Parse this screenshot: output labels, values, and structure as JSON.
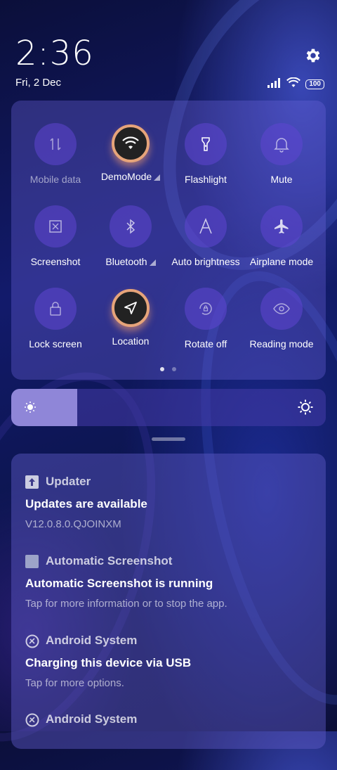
{
  "status": {
    "time": "2:36",
    "date": "Fri, 2 Dec",
    "battery": "100"
  },
  "quick_settings": {
    "tiles": [
      {
        "label": "Mobile data",
        "icon": "mobile-data-icon",
        "active": false,
        "dim": true,
        "arrow": false
      },
      {
        "label": "DemoMode",
        "icon": "wifi-icon",
        "active": true,
        "dim": false,
        "arrow": true
      },
      {
        "label": "Flashlight",
        "icon": "flashlight-icon",
        "active": false,
        "dim": false,
        "arrow": false
      },
      {
        "label": "Mute",
        "icon": "bell-icon",
        "active": false,
        "dim": false,
        "arrow": false
      },
      {
        "label": "Screenshot",
        "icon": "screenshot-icon",
        "active": false,
        "dim": false,
        "arrow": false
      },
      {
        "label": "Bluetooth",
        "icon": "bluetooth-icon",
        "active": false,
        "dim": false,
        "arrow": true
      },
      {
        "label": "Auto brightness",
        "icon": "auto-brightness-icon",
        "active": false,
        "dim": false,
        "arrow": false
      },
      {
        "label": "Airplane mode",
        "icon": "airplane-icon",
        "active": false,
        "dim": false,
        "arrow": false
      },
      {
        "label": "Lock screen",
        "icon": "lock-icon",
        "active": false,
        "dim": false,
        "arrow": false
      },
      {
        "label": "Location",
        "icon": "location-icon",
        "active": true,
        "dim": false,
        "arrow": false
      },
      {
        "label": "Rotate off",
        "icon": "rotate-lock-icon",
        "active": false,
        "dim": false,
        "arrow": false
      },
      {
        "label": "Reading mode",
        "icon": "eye-icon",
        "active": false,
        "dim": false,
        "arrow": false
      }
    ],
    "page_count": 2,
    "current_page": 1
  },
  "brightness": {
    "level": 0.21
  },
  "notifications": [
    {
      "app": "Updater",
      "app_icon": "updater-icon",
      "title": "Updates are available",
      "body": "V12.0.8.0.QJOINXM"
    },
    {
      "app": "Automatic Screenshot",
      "app_icon": "screenshot-app-icon",
      "title": "Automatic Screenshot is running",
      "body": "Tap for more information or to stop the app."
    },
    {
      "app": "Android System",
      "app_icon": "android-system-icon",
      "title": "Charging this device via USB",
      "body": "Tap for more options."
    },
    {
      "app": "Android System",
      "app_icon": "android-system-icon",
      "title": "",
      "body": ""
    }
  ],
  "colors": {
    "active_ring": "#e6a47a",
    "brightness_fill": "#8f86d8"
  }
}
